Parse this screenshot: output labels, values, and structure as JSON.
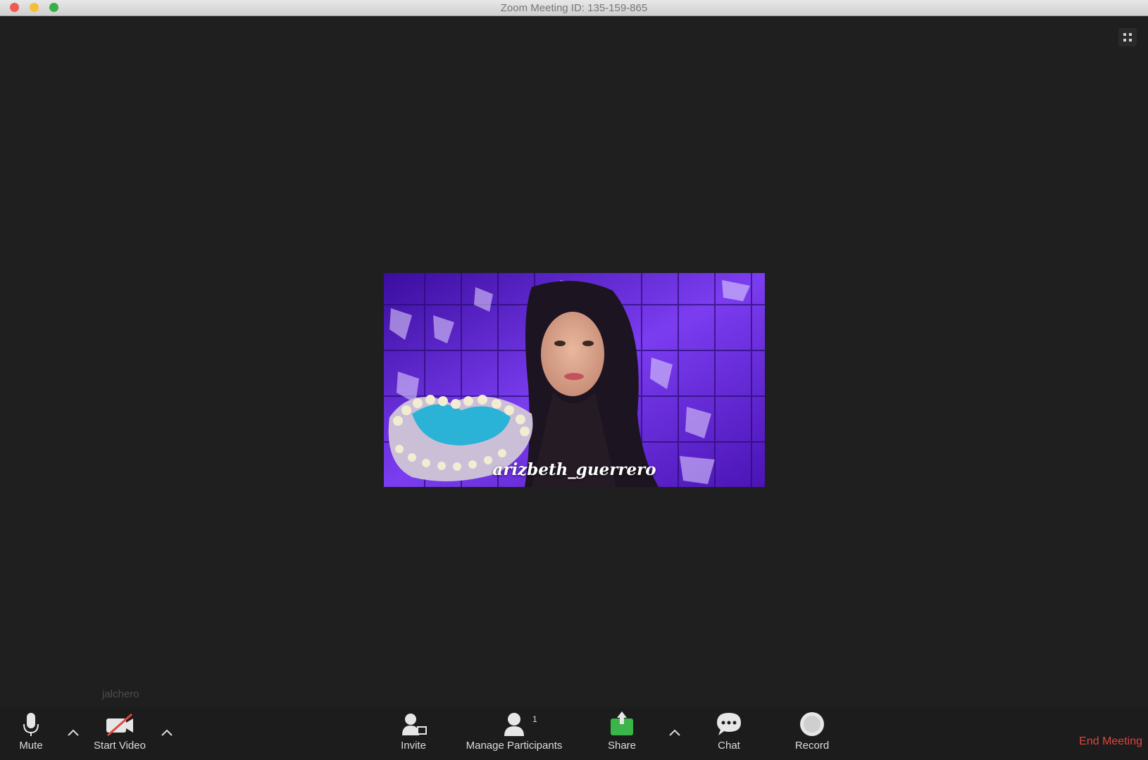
{
  "window": {
    "title": "Zoom Meeting ID: 135-159-865"
  },
  "video": {
    "overlay_text": "arizbeth_guerrero"
  },
  "self_view": {
    "name": "jalchero"
  },
  "toolbar": {
    "mute": "Mute",
    "start_video": "Start Video",
    "invite": "Invite",
    "manage_participants": "Manage Participants",
    "participant_count": "1",
    "share": "Share",
    "chat": "Chat",
    "record": "Record",
    "end_meeting": "End Meeting"
  },
  "colors": {
    "background": "#1f1f1f",
    "end_meeting": "#e0453f",
    "share_icon": "#3bb54a",
    "video_backdrop": "#5a1fc4"
  }
}
